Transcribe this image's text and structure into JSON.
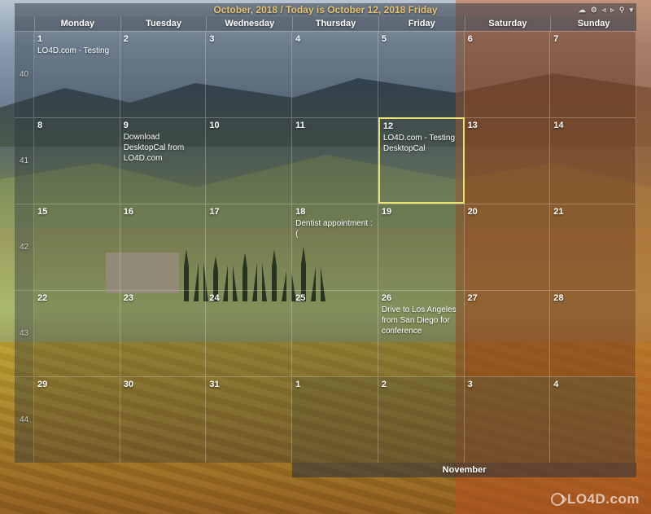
{
  "title": "October, 2018 / Today is October 12, 2018 Friday",
  "toolbar": {
    "cloud": "☁",
    "settings": "⚙",
    "prev": "◃",
    "next": "▹",
    "search": "⚲",
    "menu": "▾"
  },
  "days": [
    "Monday",
    "Tuesday",
    "Wednesday",
    "Thursday",
    "Friday",
    "Saturday",
    "Sunday"
  ],
  "weeks": [
    {
      "num": "40",
      "cells": [
        {
          "d": "1",
          "txt": "LO4D.com - Testing",
          "cls": ""
        },
        {
          "d": "2",
          "txt": "",
          "cls": ""
        },
        {
          "d": "3",
          "txt": "",
          "cls": ""
        },
        {
          "d": "4",
          "txt": "",
          "cls": ""
        },
        {
          "d": "5",
          "txt": "",
          "cls": ""
        },
        {
          "d": "6",
          "txt": "",
          "cls": "weekend"
        },
        {
          "d": "7",
          "txt": "",
          "cls": "weekend"
        }
      ]
    },
    {
      "num": "41",
      "cells": [
        {
          "d": "8",
          "txt": "",
          "cls": ""
        },
        {
          "d": "9",
          "txt": "Download DesktopCal from LO4D.com",
          "cls": ""
        },
        {
          "d": "10",
          "txt": "",
          "cls": ""
        },
        {
          "d": "11",
          "txt": "",
          "cls": ""
        },
        {
          "d": "12",
          "txt": "LO4D.com - Testing DesktopCal",
          "cls": "today"
        },
        {
          "d": "13",
          "txt": "",
          "cls": "weekend"
        },
        {
          "d": "14",
          "txt": "",
          "cls": "weekend"
        }
      ]
    },
    {
      "num": "42",
      "cells": [
        {
          "d": "15",
          "txt": "",
          "cls": ""
        },
        {
          "d": "16",
          "txt": "",
          "cls": ""
        },
        {
          "d": "17",
          "txt": "",
          "cls": ""
        },
        {
          "d": "18",
          "txt": "Dentist appointment :(",
          "cls": ""
        },
        {
          "d": "19",
          "txt": "",
          "cls": ""
        },
        {
          "d": "20",
          "txt": "",
          "cls": "weekend"
        },
        {
          "d": "21",
          "txt": "",
          "cls": "weekend"
        }
      ]
    },
    {
      "num": "43",
      "cells": [
        {
          "d": "22",
          "txt": "",
          "cls": ""
        },
        {
          "d": "23",
          "txt": "",
          "cls": ""
        },
        {
          "d": "24",
          "txt": "",
          "cls": ""
        },
        {
          "d": "25",
          "txt": "",
          "cls": ""
        },
        {
          "d": "26",
          "txt": "Drive to Los Angeles from San Diego for conference",
          "cls": ""
        },
        {
          "d": "27",
          "txt": "",
          "cls": "weekend"
        },
        {
          "d": "28",
          "txt": "",
          "cls": "weekend"
        }
      ]
    },
    {
      "num": "44",
      "cells": [
        {
          "d": "29",
          "txt": "",
          "cls": ""
        },
        {
          "d": "30",
          "txt": "",
          "cls": ""
        },
        {
          "d": "31",
          "txt": "",
          "cls": ""
        },
        {
          "d": "1",
          "txt": "",
          "cls": "other-month"
        },
        {
          "d": "2",
          "txt": "",
          "cls": "other-month"
        },
        {
          "d": "3",
          "txt": "",
          "cls": "other-month weekend"
        },
        {
          "d": "4",
          "txt": "",
          "cls": "other-month weekend"
        }
      ]
    }
  ],
  "next_month_label": "November",
  "watermark": "LO4D.com"
}
